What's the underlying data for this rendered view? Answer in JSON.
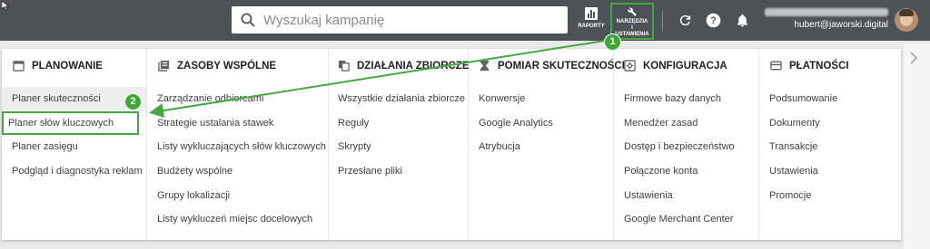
{
  "search": {
    "placeholder": "Wyszukaj kampanię"
  },
  "toolbar": {
    "reports_label": "RAPORTY",
    "tools_label": [
      "NARZĘDZIA",
      "I",
      "USTAWIENIA"
    ]
  },
  "account": {
    "email": "hubert@jaworski.digital"
  },
  "columns": [
    {
      "title": "PLANOWANIE",
      "icon": "calendar-icon",
      "items": [
        "Planer skuteczności",
        "Planer słów kluczowych",
        "Planer zasięgu",
        "Podgląd i diagnostyka reklam"
      ]
    },
    {
      "title": "ZASOBY WSPÓLNE",
      "icon": "library-icon",
      "items": [
        "Zarządzanie odbiorcami",
        "Strategie ustalania stawek",
        "Listy wykluczających słów kluczowych",
        "Budżety wspólne",
        "Grupy lokalizacji",
        "Listy wykluczeń miejsc docelowych"
      ]
    },
    {
      "title": "DZIAŁANIA ZBIORCZE",
      "icon": "copy-icon",
      "items": [
        "Wszystkie działania zbiorcze",
        "Reguły",
        "Skrypty",
        "Przesłane pliki"
      ]
    },
    {
      "title": "POMIAR SKUTECZNOŚCI",
      "icon": "hourglass-icon",
      "items": [
        "Konwersje",
        "Google Analytics",
        "Atrybucja"
      ]
    },
    {
      "title": "KONFIGURACJA",
      "icon": "settings-box-icon",
      "items": [
        "Firmowe bazy danych",
        "Menedżer zasad",
        "Dostęp i bezpieczeństwo",
        "Połączone konta",
        "Ustawienia",
        "Google Merchant Center"
      ]
    },
    {
      "title": "PŁATNOŚCI",
      "icon": "credit-card-icon",
      "items": [
        "Podsumowanie",
        "Dokumenty",
        "Transakcje",
        "Ustawienia",
        "Promocje"
      ]
    }
  ],
  "annotations": {
    "step1": "1",
    "step2": "2",
    "color": "#43a83f"
  }
}
